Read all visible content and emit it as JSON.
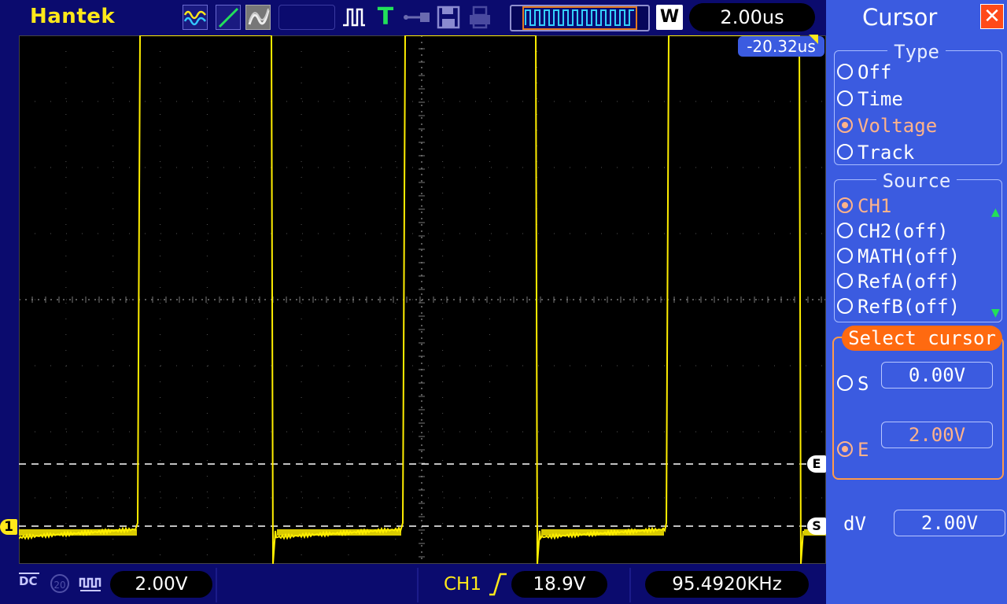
{
  "brand": "Hantek",
  "toolbar": {
    "timebase": "2.00us",
    "w_label": "W"
  },
  "screen": {
    "trigger_offset": "-20.32us",
    "cursor_e_label": "E",
    "cursor_s_label": "S",
    "ch1_marker": "1"
  },
  "bottom": {
    "coupling": "DC",
    "bw_label": "20",
    "volts_div": "2.00V",
    "trig_source": "CH1",
    "trig_level": "18.9V",
    "frequency": "95.4920KHz"
  },
  "panel": {
    "title": "Cursor",
    "close": "✕",
    "type_title": "Type",
    "type_options": [
      "Off",
      "Time",
      "Voltage",
      "Track"
    ],
    "type_selected": "Voltage",
    "source_title": "Source",
    "source_options": [
      "CH1",
      "CH2(off)",
      "MATH(off)",
      "RefA(off)",
      "RefB(off)"
    ],
    "source_selected": "CH1",
    "select_title": "Select cursor",
    "s_label": "S",
    "s_value": "0.00V",
    "e_label": "E",
    "e_value": "2.00V",
    "dv_label": "dV",
    "dv_value": "2.00V"
  },
  "colors": {
    "trace": "#ffee00",
    "panel_bg": "#3b5be0",
    "accent": "#ff6a10",
    "frame_bg": "#0b0b6e"
  }
}
